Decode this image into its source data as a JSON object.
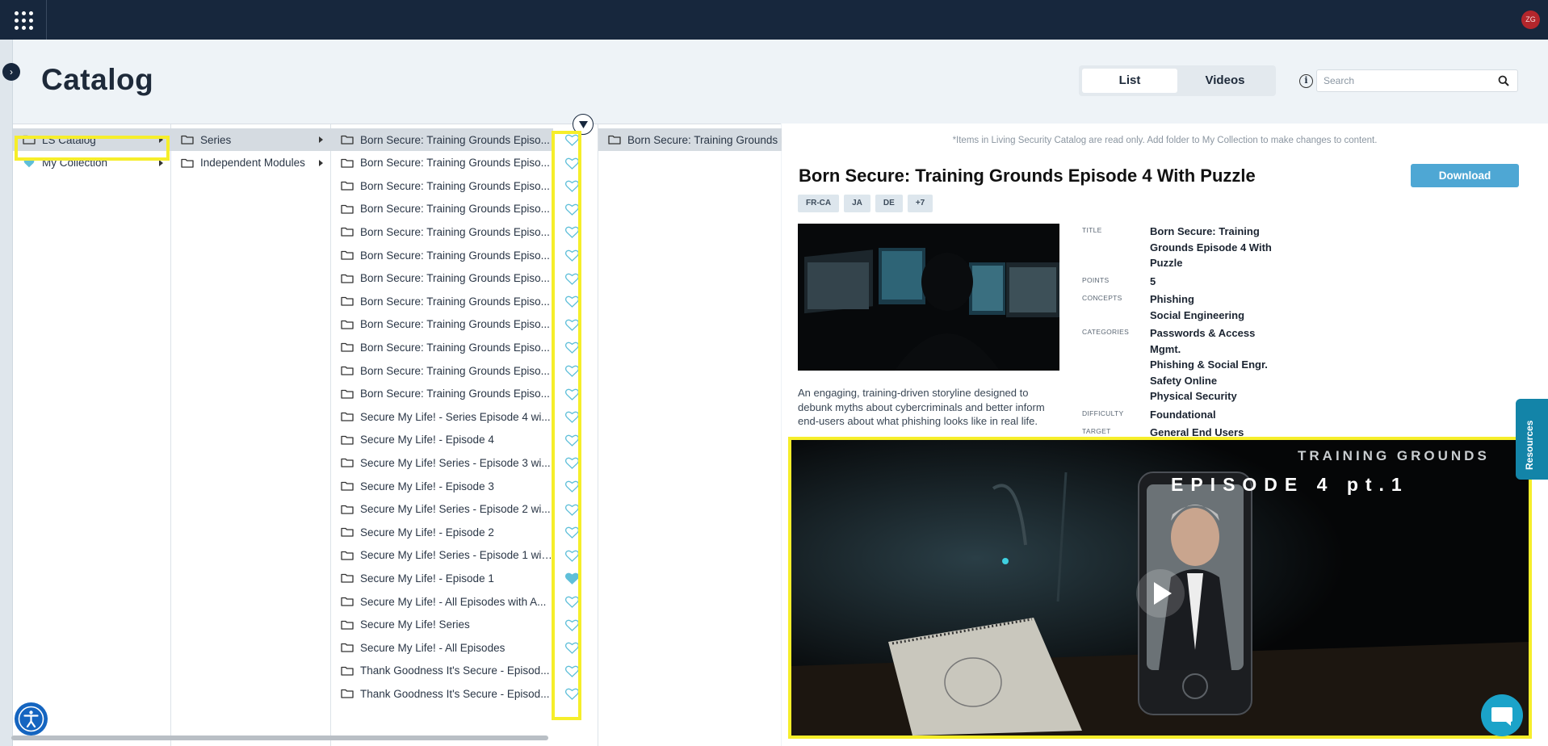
{
  "colors": {
    "topbar": "#17273d",
    "accent": "#4ea7d4",
    "highlight": "#f6ee2a",
    "heart": "#5fbfd9"
  },
  "header": {
    "avatar_initials": "ZG"
  },
  "page": {
    "title": "Catalog"
  },
  "view_toggle": {
    "list_label": "List",
    "videos_label": "Videos",
    "active": "List"
  },
  "search": {
    "placeholder": "Search",
    "value": ""
  },
  "columns": {
    "roots": [
      {
        "label": "LS Catalog",
        "icon": "folder-icon",
        "selected": true
      },
      {
        "label": "My Collection",
        "icon": "heart-icon",
        "selected": false
      }
    ],
    "groups": [
      {
        "label": "Series",
        "selected": true
      },
      {
        "label": "Independent Modules",
        "selected": false
      }
    ],
    "items": [
      {
        "label": "Born Secure: Training Grounds Episo...",
        "favorite": false
      },
      {
        "label": "Born Secure: Training Grounds Episo...",
        "favorite": false
      },
      {
        "label": "Born Secure: Training Grounds Episo...",
        "favorite": false
      },
      {
        "label": "Born Secure: Training Grounds Episo...",
        "favorite": false
      },
      {
        "label": "Born Secure: Training Grounds Episo...",
        "favorite": false
      },
      {
        "label": "Born Secure: Training Grounds Episo...",
        "favorite": false
      },
      {
        "label": "Born Secure: Training Grounds Episo...",
        "favorite": false
      },
      {
        "label": "Born Secure: Training Grounds Episo...",
        "favorite": false
      },
      {
        "label": "Born Secure: Training Grounds Episo...",
        "favorite": false
      },
      {
        "label": "Born Secure: Training Grounds Episo...",
        "favorite": false
      },
      {
        "label": "Born Secure: Training Grounds Episo...",
        "favorite": false
      },
      {
        "label": "Born Secure: Training Grounds Episo...",
        "favorite": false
      },
      {
        "label": "Secure My Life! - Series Episode 4 wi...",
        "favorite": false
      },
      {
        "label": "Secure My Life! - Episode 4",
        "favorite": false
      },
      {
        "label": "Secure My Life! Series - Episode 3 wi...",
        "favorite": false
      },
      {
        "label": "Secure My Life! - Episode 3",
        "favorite": false
      },
      {
        "label": "Secure My Life! Series - Episode 2 wi...",
        "favorite": false
      },
      {
        "label": "Secure My Life! - Episode 2",
        "favorite": false
      },
      {
        "label": "Secure My Life! Series - Episode 1 wit...",
        "favorite": false
      },
      {
        "label": "Secure My Life! - Episode 1",
        "favorite": true
      },
      {
        "label": "Secure My Life! - All Episodes with A...",
        "favorite": false
      },
      {
        "label": "Secure My Life! Series",
        "favorite": false
      },
      {
        "label": "Secure My Life! - All Episodes",
        "favorite": false
      },
      {
        "label": "Thank Goodness It's Secure - Episod...",
        "favorite": false
      },
      {
        "label": "Thank Goodness It's Secure - Episod...",
        "favorite": false
      }
    ],
    "children": [
      {
        "label": "Born Secure: Training Grounds E"
      }
    ]
  },
  "detail": {
    "readonly_note": "*Items in Living Security Catalog are read only. Add folder to My Collection to make changes to content.",
    "title": "Born Secure: Training Grounds Episode 4 With Puzzle",
    "download_label": "Download",
    "languages": [
      "FR-CA",
      "JA",
      "DE",
      "+7"
    ],
    "description": "An engaging, training-driven storyline designed to debunk myths about cybercriminals and better inform end-users about what phishing looks like in real life.",
    "meta": [
      {
        "key": "TITLE",
        "values": [
          "Born Secure: Training",
          "Grounds Episode 4 With",
          "Puzzle"
        ]
      },
      {
        "key": "POINTS",
        "values": [
          "5"
        ]
      },
      {
        "key": "CONCEPTS",
        "values": [
          "Phishing",
          "Social Engineering"
        ]
      },
      {
        "key": "CATEGORIES",
        "values": [
          "Passwords & Access",
          "Mgmt.",
          "Phishing & Social Engr.",
          "Safety Online",
          "Physical Security"
        ]
      },
      {
        "key": "DIFFICULTY",
        "values": [
          "Foundational"
        ]
      },
      {
        "key": "TARGET",
        "values": [
          "General End Users"
        ]
      }
    ]
  },
  "video": {
    "brand": "TRAINING GROUNDS",
    "episode": "EPISODE 4 pt.1"
  },
  "resources_tab": {
    "label": "Resources"
  }
}
